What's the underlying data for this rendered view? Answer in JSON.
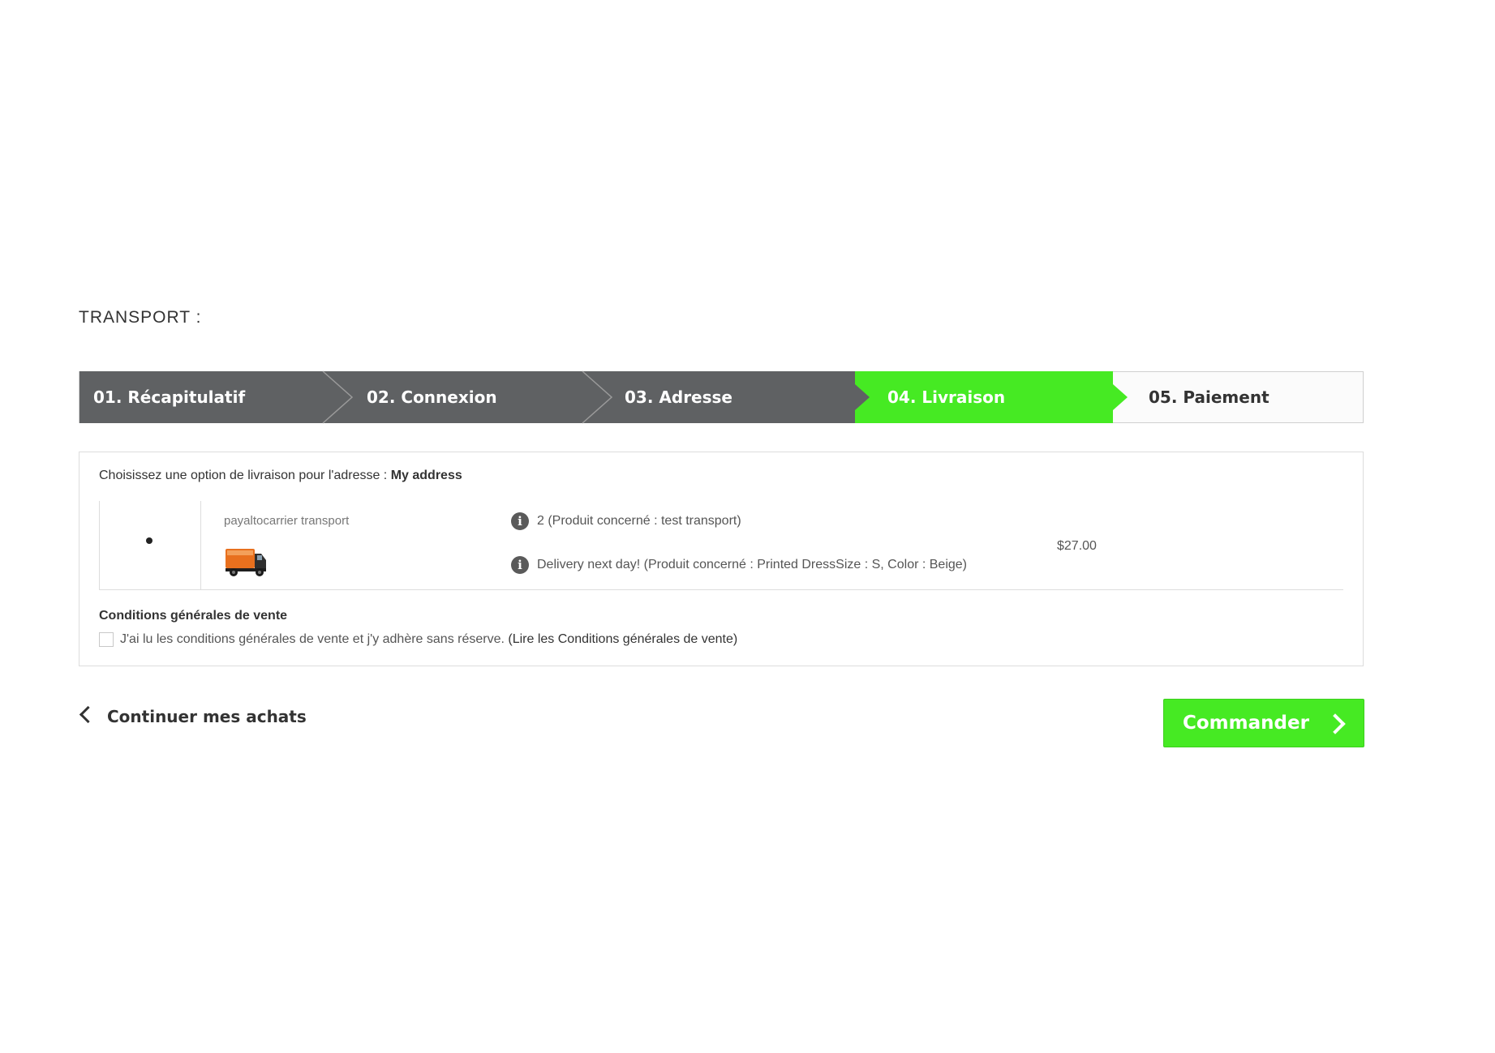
{
  "page": {
    "heading": "TRANSPORT :"
  },
  "steps": [
    {
      "label": "01. Récapitulatif",
      "state": "done"
    },
    {
      "label": "02. Connexion",
      "state": "done"
    },
    {
      "label": "03. Adresse",
      "state": "done"
    },
    {
      "label": "04. Livraison",
      "state": "current"
    },
    {
      "label": "05. Paiement",
      "state": "todo"
    }
  ],
  "delivery": {
    "question_prefix": "Choisissez une option de livraison pour l'adresse :",
    "address_name": "My address",
    "option": {
      "selected": true,
      "carrier_name": "payaltocarrier transport",
      "carrier_logo_icon": "delivery-truck-icon",
      "delays": [
        "2 (Produit concerné : test transport)",
        "Delivery next day! (Produit concerné : Printed DressSize : S, Color : Beige)"
      ],
      "info_icon": "info-icon",
      "price": "$27.00"
    }
  },
  "terms": {
    "title": "Conditions générales de vente",
    "checked": false,
    "agree_text": "J'ai lu les conditions générales de vente et j'y adhère sans réserve.",
    "link_text": "(Lire les Conditions générales de vente)"
  },
  "nav": {
    "continue_label": "Continuer mes achats",
    "order_label": "Commander"
  },
  "colors": {
    "accent_green": "#46ea23",
    "step_done_bg": "#5f6163",
    "step_todo_bg": "#fbfbfb"
  }
}
